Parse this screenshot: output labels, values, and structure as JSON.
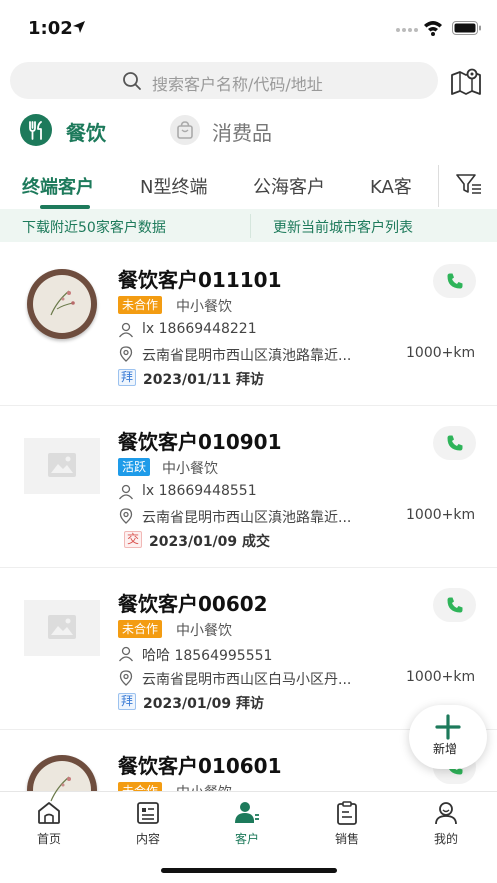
{
  "status_bar": {
    "time": "1:02"
  },
  "search": {
    "placeholder": "搜索客户名称/代码/地址"
  },
  "business_tabs": [
    {
      "label": "餐饮",
      "active": true
    },
    {
      "label": "消费品",
      "active": false
    }
  ],
  "category_tabs": [
    {
      "label": "终端客户",
      "active": true
    },
    {
      "label": "N型终端",
      "active": false
    },
    {
      "label": "公海客户",
      "active": false
    },
    {
      "label": "KA客",
      "active": false
    }
  ],
  "actions": {
    "download": "下载附近50家客户数据",
    "update": "更新当前城市客户列表"
  },
  "customers": [
    {
      "name": "餐饮客户011101",
      "status": "未合作",
      "status_color": "#f39c12",
      "type": "中小餐饮",
      "contact": "lx 18669448221",
      "address": "云南省昆明市西山区滇池路靠近...",
      "distance": "1000+km",
      "visit_badge": "拜",
      "visit": "2023/01/11 拜访"
    },
    {
      "name": "餐饮客户010901",
      "status": "活跃",
      "status_color": "#1e9be9",
      "type": "中小餐饮",
      "contact": "lx 18669448551",
      "address": "云南省昆明市西山区滇池路靠近...",
      "distance": "1000+km",
      "visit_badge": "交",
      "visit": "2023/01/09 成交"
    },
    {
      "name": "餐饮客户00602",
      "status": "未合作",
      "status_color": "#f39c12",
      "type": "中小餐饮",
      "contact": "哈哈 18564995551",
      "address": "云南省昆明市西山区白马小区丹...",
      "distance": "1000+km",
      "visit_badge": "拜",
      "visit": "2023/01/09 拜访"
    },
    {
      "name": "餐饮客户010601",
      "status": "未合作",
      "status_color": "#f39c12",
      "type": "中小餐饮"
    }
  ],
  "fab": {
    "label": "新增"
  },
  "nav": [
    {
      "label": "首页",
      "icon": "home-icon"
    },
    {
      "label": "内容",
      "icon": "content-icon"
    },
    {
      "label": "客户",
      "icon": "customer-icon",
      "active": true
    },
    {
      "label": "销售",
      "icon": "sales-icon"
    },
    {
      "label": "我的",
      "icon": "profile-icon"
    }
  ],
  "colors": {
    "brand": "#1d7a5b",
    "inactive_status": "#f39c12",
    "active_status": "#1e9be9"
  }
}
